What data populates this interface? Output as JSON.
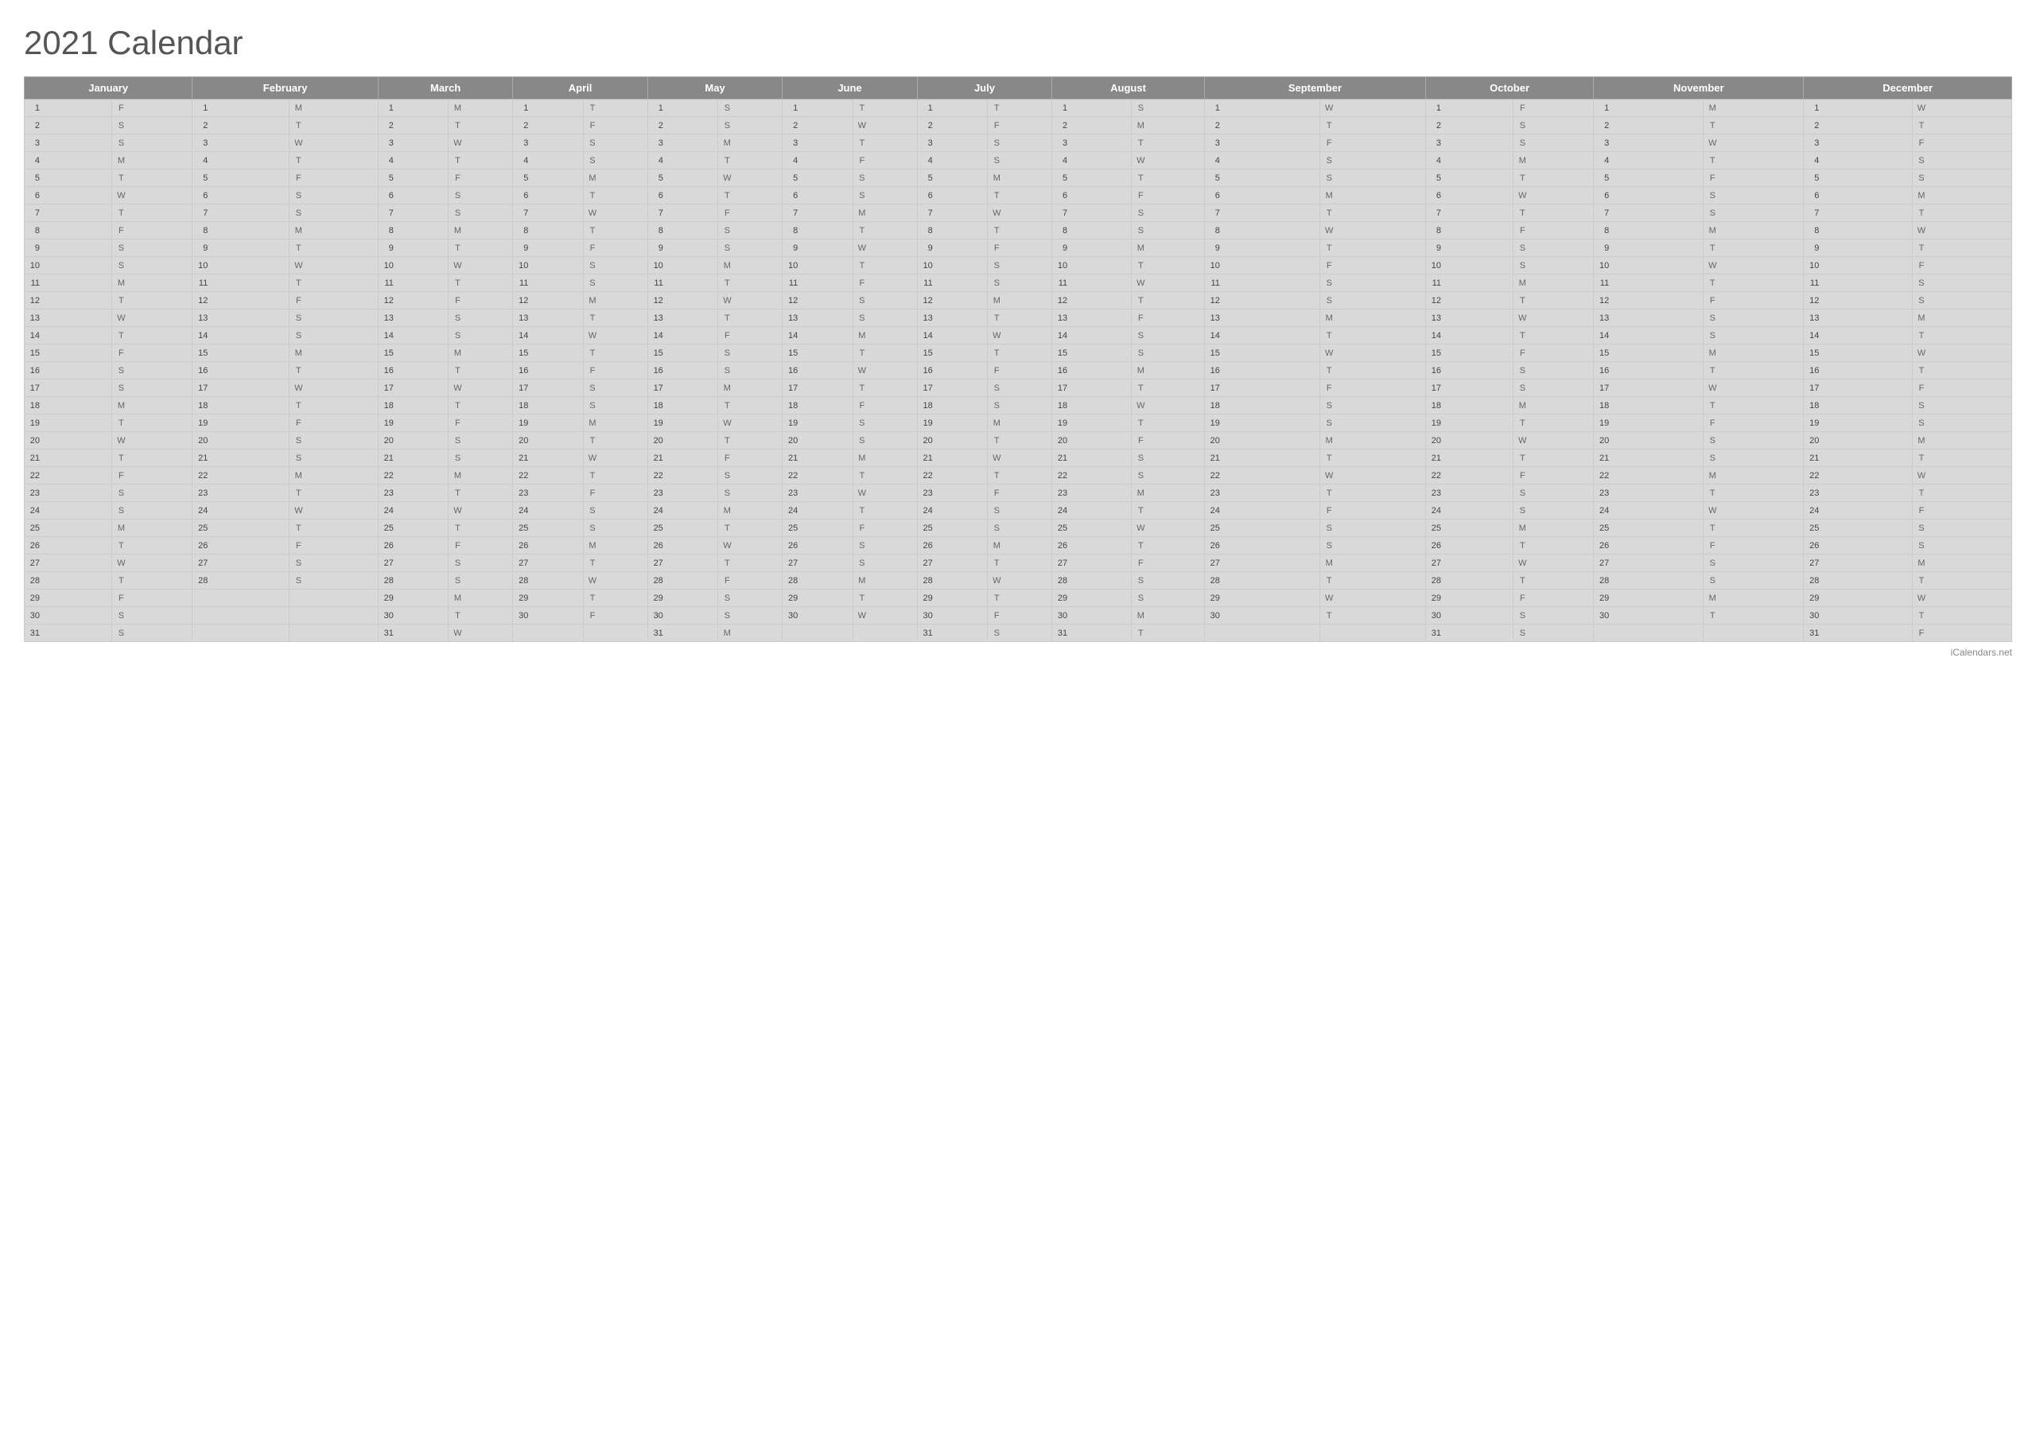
{
  "title": "2021 Calendar",
  "footer": "iCalendars.net",
  "months": [
    "January",
    "February",
    "March",
    "April",
    "May",
    "June",
    "July",
    "August",
    "September",
    "October",
    "November",
    "December"
  ],
  "calendar": {
    "January": [
      [
        1,
        "F"
      ],
      [
        2,
        "S"
      ],
      [
        3,
        "S"
      ],
      [
        4,
        "M"
      ],
      [
        5,
        "T"
      ],
      [
        6,
        "W"
      ],
      [
        7,
        "T"
      ],
      [
        8,
        "F"
      ],
      [
        9,
        "S"
      ],
      [
        10,
        "S"
      ],
      [
        11,
        "M"
      ],
      [
        12,
        "T"
      ],
      [
        13,
        "W"
      ],
      [
        14,
        "T"
      ],
      [
        15,
        "F"
      ],
      [
        16,
        "S"
      ],
      [
        17,
        "S"
      ],
      [
        18,
        "M"
      ],
      [
        19,
        "T"
      ],
      [
        20,
        "W"
      ],
      [
        21,
        "T"
      ],
      [
        22,
        "F"
      ],
      [
        23,
        "S"
      ],
      [
        24,
        "S"
      ],
      [
        25,
        "M"
      ],
      [
        26,
        "T"
      ],
      [
        27,
        "W"
      ],
      [
        28,
        "T"
      ],
      [
        29,
        "F"
      ],
      [
        30,
        "S"
      ],
      [
        31,
        "S"
      ]
    ],
    "February": [
      [
        1,
        "M"
      ],
      [
        2,
        "T"
      ],
      [
        3,
        "W"
      ],
      [
        4,
        "T"
      ],
      [
        5,
        "F"
      ],
      [
        6,
        "S"
      ],
      [
        7,
        "S"
      ],
      [
        8,
        "M"
      ],
      [
        9,
        "T"
      ],
      [
        10,
        "W"
      ],
      [
        11,
        "T"
      ],
      [
        12,
        "F"
      ],
      [
        13,
        "S"
      ],
      [
        14,
        "S"
      ],
      [
        15,
        "M"
      ],
      [
        16,
        "T"
      ],
      [
        17,
        "W"
      ],
      [
        18,
        "T"
      ],
      [
        19,
        "F"
      ],
      [
        20,
        "S"
      ],
      [
        21,
        "S"
      ],
      [
        22,
        "M"
      ],
      [
        23,
        "T"
      ],
      [
        24,
        "W"
      ],
      [
        25,
        "T"
      ],
      [
        26,
        "F"
      ],
      [
        27,
        "S"
      ],
      [
        28,
        "S"
      ]
    ],
    "March": [
      [
        1,
        "M"
      ],
      [
        2,
        "T"
      ],
      [
        3,
        "W"
      ],
      [
        4,
        "T"
      ],
      [
        5,
        "F"
      ],
      [
        6,
        "S"
      ],
      [
        7,
        "S"
      ],
      [
        8,
        "M"
      ],
      [
        9,
        "T"
      ],
      [
        10,
        "W"
      ],
      [
        11,
        "T"
      ],
      [
        12,
        "F"
      ],
      [
        13,
        "S"
      ],
      [
        14,
        "S"
      ],
      [
        15,
        "M"
      ],
      [
        16,
        "T"
      ],
      [
        17,
        "W"
      ],
      [
        18,
        "T"
      ],
      [
        19,
        "F"
      ],
      [
        20,
        "S"
      ],
      [
        21,
        "S"
      ],
      [
        22,
        "M"
      ],
      [
        23,
        "T"
      ],
      [
        24,
        "W"
      ],
      [
        25,
        "T"
      ],
      [
        26,
        "F"
      ],
      [
        27,
        "S"
      ],
      [
        28,
        "S"
      ],
      [
        29,
        "M"
      ],
      [
        30,
        "T"
      ],
      [
        31,
        "W"
      ]
    ],
    "April": [
      [
        1,
        "T"
      ],
      [
        2,
        "F"
      ],
      [
        3,
        "S"
      ],
      [
        4,
        "S"
      ],
      [
        5,
        "M"
      ],
      [
        6,
        "T"
      ],
      [
        7,
        "W"
      ],
      [
        8,
        "T"
      ],
      [
        9,
        "F"
      ],
      [
        10,
        "S"
      ],
      [
        11,
        "S"
      ],
      [
        12,
        "M"
      ],
      [
        13,
        "T"
      ],
      [
        14,
        "W"
      ],
      [
        15,
        "T"
      ],
      [
        16,
        "F"
      ],
      [
        17,
        "S"
      ],
      [
        18,
        "S"
      ],
      [
        19,
        "M"
      ],
      [
        20,
        "T"
      ],
      [
        21,
        "W"
      ],
      [
        22,
        "T"
      ],
      [
        23,
        "F"
      ],
      [
        24,
        "S"
      ],
      [
        25,
        "S"
      ],
      [
        26,
        "M"
      ],
      [
        27,
        "T"
      ],
      [
        28,
        "W"
      ],
      [
        29,
        "T"
      ],
      [
        30,
        "F"
      ]
    ],
    "May": [
      [
        1,
        "S"
      ],
      [
        2,
        "S"
      ],
      [
        3,
        "M"
      ],
      [
        4,
        "T"
      ],
      [
        5,
        "W"
      ],
      [
        6,
        "T"
      ],
      [
        7,
        "F"
      ],
      [
        8,
        "S"
      ],
      [
        9,
        "S"
      ],
      [
        10,
        "M"
      ],
      [
        11,
        "T"
      ],
      [
        12,
        "W"
      ],
      [
        13,
        "T"
      ],
      [
        14,
        "F"
      ],
      [
        15,
        "S"
      ],
      [
        16,
        "S"
      ],
      [
        17,
        "M"
      ],
      [
        18,
        "T"
      ],
      [
        19,
        "W"
      ],
      [
        20,
        "T"
      ],
      [
        21,
        "F"
      ],
      [
        22,
        "S"
      ],
      [
        23,
        "S"
      ],
      [
        24,
        "M"
      ],
      [
        25,
        "T"
      ],
      [
        26,
        "W"
      ],
      [
        27,
        "T"
      ],
      [
        28,
        "F"
      ],
      [
        29,
        "S"
      ],
      [
        30,
        "S"
      ],
      [
        31,
        "M"
      ]
    ],
    "June": [
      [
        1,
        "T"
      ],
      [
        2,
        "W"
      ],
      [
        3,
        "T"
      ],
      [
        4,
        "F"
      ],
      [
        5,
        "S"
      ],
      [
        6,
        "S"
      ],
      [
        7,
        "M"
      ],
      [
        8,
        "T"
      ],
      [
        9,
        "W"
      ],
      [
        10,
        "T"
      ],
      [
        11,
        "F"
      ],
      [
        12,
        "S"
      ],
      [
        13,
        "S"
      ],
      [
        14,
        "M"
      ],
      [
        15,
        "T"
      ],
      [
        16,
        "W"
      ],
      [
        17,
        "T"
      ],
      [
        18,
        "F"
      ],
      [
        19,
        "S"
      ],
      [
        20,
        "S"
      ],
      [
        21,
        "M"
      ],
      [
        22,
        "T"
      ],
      [
        23,
        "W"
      ],
      [
        24,
        "T"
      ],
      [
        25,
        "F"
      ],
      [
        26,
        "S"
      ],
      [
        27,
        "S"
      ],
      [
        28,
        "M"
      ],
      [
        29,
        "T"
      ],
      [
        30,
        "W"
      ]
    ],
    "July": [
      [
        1,
        "T"
      ],
      [
        2,
        "F"
      ],
      [
        3,
        "S"
      ],
      [
        4,
        "S"
      ],
      [
        5,
        "M"
      ],
      [
        6,
        "T"
      ],
      [
        7,
        "W"
      ],
      [
        8,
        "T"
      ],
      [
        9,
        "F"
      ],
      [
        10,
        "S"
      ],
      [
        11,
        "S"
      ],
      [
        12,
        "M"
      ],
      [
        13,
        "T"
      ],
      [
        14,
        "W"
      ],
      [
        15,
        "T"
      ],
      [
        16,
        "F"
      ],
      [
        17,
        "S"
      ],
      [
        18,
        "S"
      ],
      [
        19,
        "M"
      ],
      [
        20,
        "T"
      ],
      [
        21,
        "W"
      ],
      [
        22,
        "T"
      ],
      [
        23,
        "F"
      ],
      [
        24,
        "S"
      ],
      [
        25,
        "S"
      ],
      [
        26,
        "M"
      ],
      [
        27,
        "T"
      ],
      [
        28,
        "W"
      ],
      [
        29,
        "T"
      ],
      [
        30,
        "F"
      ],
      [
        31,
        "S"
      ]
    ],
    "August": [
      [
        1,
        "S"
      ],
      [
        2,
        "M"
      ],
      [
        3,
        "T"
      ],
      [
        4,
        "W"
      ],
      [
        5,
        "T"
      ],
      [
        6,
        "F"
      ],
      [
        7,
        "S"
      ],
      [
        8,
        "S"
      ],
      [
        9,
        "M"
      ],
      [
        10,
        "T"
      ],
      [
        11,
        "W"
      ],
      [
        12,
        "T"
      ],
      [
        13,
        "F"
      ],
      [
        14,
        "S"
      ],
      [
        15,
        "S"
      ],
      [
        16,
        "M"
      ],
      [
        17,
        "T"
      ],
      [
        18,
        "W"
      ],
      [
        19,
        "T"
      ],
      [
        20,
        "F"
      ],
      [
        21,
        "S"
      ],
      [
        22,
        "S"
      ],
      [
        23,
        "M"
      ],
      [
        24,
        "T"
      ],
      [
        25,
        "W"
      ],
      [
        26,
        "T"
      ],
      [
        27,
        "F"
      ],
      [
        28,
        "S"
      ],
      [
        29,
        "S"
      ],
      [
        30,
        "M"
      ],
      [
        31,
        "T"
      ]
    ],
    "September": [
      [
        1,
        "W"
      ],
      [
        2,
        "T"
      ],
      [
        3,
        "F"
      ],
      [
        4,
        "S"
      ],
      [
        5,
        "S"
      ],
      [
        6,
        "M"
      ],
      [
        7,
        "T"
      ],
      [
        8,
        "W"
      ],
      [
        9,
        "T"
      ],
      [
        10,
        "F"
      ],
      [
        11,
        "S"
      ],
      [
        12,
        "S"
      ],
      [
        13,
        "M"
      ],
      [
        14,
        "T"
      ],
      [
        15,
        "W"
      ],
      [
        16,
        "T"
      ],
      [
        17,
        "F"
      ],
      [
        18,
        "S"
      ],
      [
        19,
        "S"
      ],
      [
        20,
        "M"
      ],
      [
        21,
        "T"
      ],
      [
        22,
        "W"
      ],
      [
        23,
        "T"
      ],
      [
        24,
        "F"
      ],
      [
        25,
        "S"
      ],
      [
        26,
        "S"
      ],
      [
        27,
        "M"
      ],
      [
        28,
        "T"
      ],
      [
        29,
        "W"
      ],
      [
        30,
        "T"
      ]
    ],
    "October": [
      [
        1,
        "F"
      ],
      [
        2,
        "S"
      ],
      [
        3,
        "S"
      ],
      [
        4,
        "M"
      ],
      [
        5,
        "T"
      ],
      [
        6,
        "W"
      ],
      [
        7,
        "T"
      ],
      [
        8,
        "F"
      ],
      [
        9,
        "S"
      ],
      [
        10,
        "S"
      ],
      [
        11,
        "M"
      ],
      [
        12,
        "T"
      ],
      [
        13,
        "W"
      ],
      [
        14,
        "T"
      ],
      [
        15,
        "F"
      ],
      [
        16,
        "S"
      ],
      [
        17,
        "S"
      ],
      [
        18,
        "M"
      ],
      [
        19,
        "T"
      ],
      [
        20,
        "W"
      ],
      [
        21,
        "T"
      ],
      [
        22,
        "F"
      ],
      [
        23,
        "S"
      ],
      [
        24,
        "S"
      ],
      [
        25,
        "M"
      ],
      [
        26,
        "T"
      ],
      [
        27,
        "W"
      ],
      [
        28,
        "T"
      ],
      [
        29,
        "F"
      ],
      [
        30,
        "S"
      ],
      [
        31,
        "S"
      ]
    ],
    "November": [
      [
        1,
        "M"
      ],
      [
        2,
        "T"
      ],
      [
        3,
        "W"
      ],
      [
        4,
        "T"
      ],
      [
        5,
        "F"
      ],
      [
        6,
        "S"
      ],
      [
        7,
        "S"
      ],
      [
        8,
        "M"
      ],
      [
        9,
        "T"
      ],
      [
        10,
        "W"
      ],
      [
        11,
        "T"
      ],
      [
        12,
        "F"
      ],
      [
        13,
        "S"
      ],
      [
        14,
        "S"
      ],
      [
        15,
        "M"
      ],
      [
        16,
        "T"
      ],
      [
        17,
        "W"
      ],
      [
        18,
        "T"
      ],
      [
        19,
        "F"
      ],
      [
        20,
        "S"
      ],
      [
        21,
        "S"
      ],
      [
        22,
        "M"
      ],
      [
        23,
        "T"
      ],
      [
        24,
        "W"
      ],
      [
        25,
        "T"
      ],
      [
        26,
        "F"
      ],
      [
        27,
        "S"
      ],
      [
        28,
        "S"
      ],
      [
        29,
        "M"
      ],
      [
        30,
        "T"
      ]
    ],
    "December": [
      [
        1,
        "W"
      ],
      [
        2,
        "T"
      ],
      [
        3,
        "F"
      ],
      [
        4,
        "S"
      ],
      [
        5,
        "S"
      ],
      [
        6,
        "M"
      ],
      [
        7,
        "T"
      ],
      [
        8,
        "W"
      ],
      [
        9,
        "T"
      ],
      [
        10,
        "F"
      ],
      [
        11,
        "S"
      ],
      [
        12,
        "S"
      ],
      [
        13,
        "M"
      ],
      [
        14,
        "T"
      ],
      [
        15,
        "W"
      ],
      [
        16,
        "T"
      ],
      [
        17,
        "F"
      ],
      [
        18,
        "S"
      ],
      [
        19,
        "S"
      ],
      [
        20,
        "M"
      ],
      [
        21,
        "T"
      ],
      [
        22,
        "W"
      ],
      [
        23,
        "T"
      ],
      [
        24,
        "F"
      ],
      [
        25,
        "S"
      ],
      [
        26,
        "S"
      ],
      [
        27,
        "M"
      ],
      [
        28,
        "T"
      ],
      [
        29,
        "W"
      ],
      [
        30,
        "T"
      ],
      [
        31,
        "F"
      ]
    ]
  }
}
